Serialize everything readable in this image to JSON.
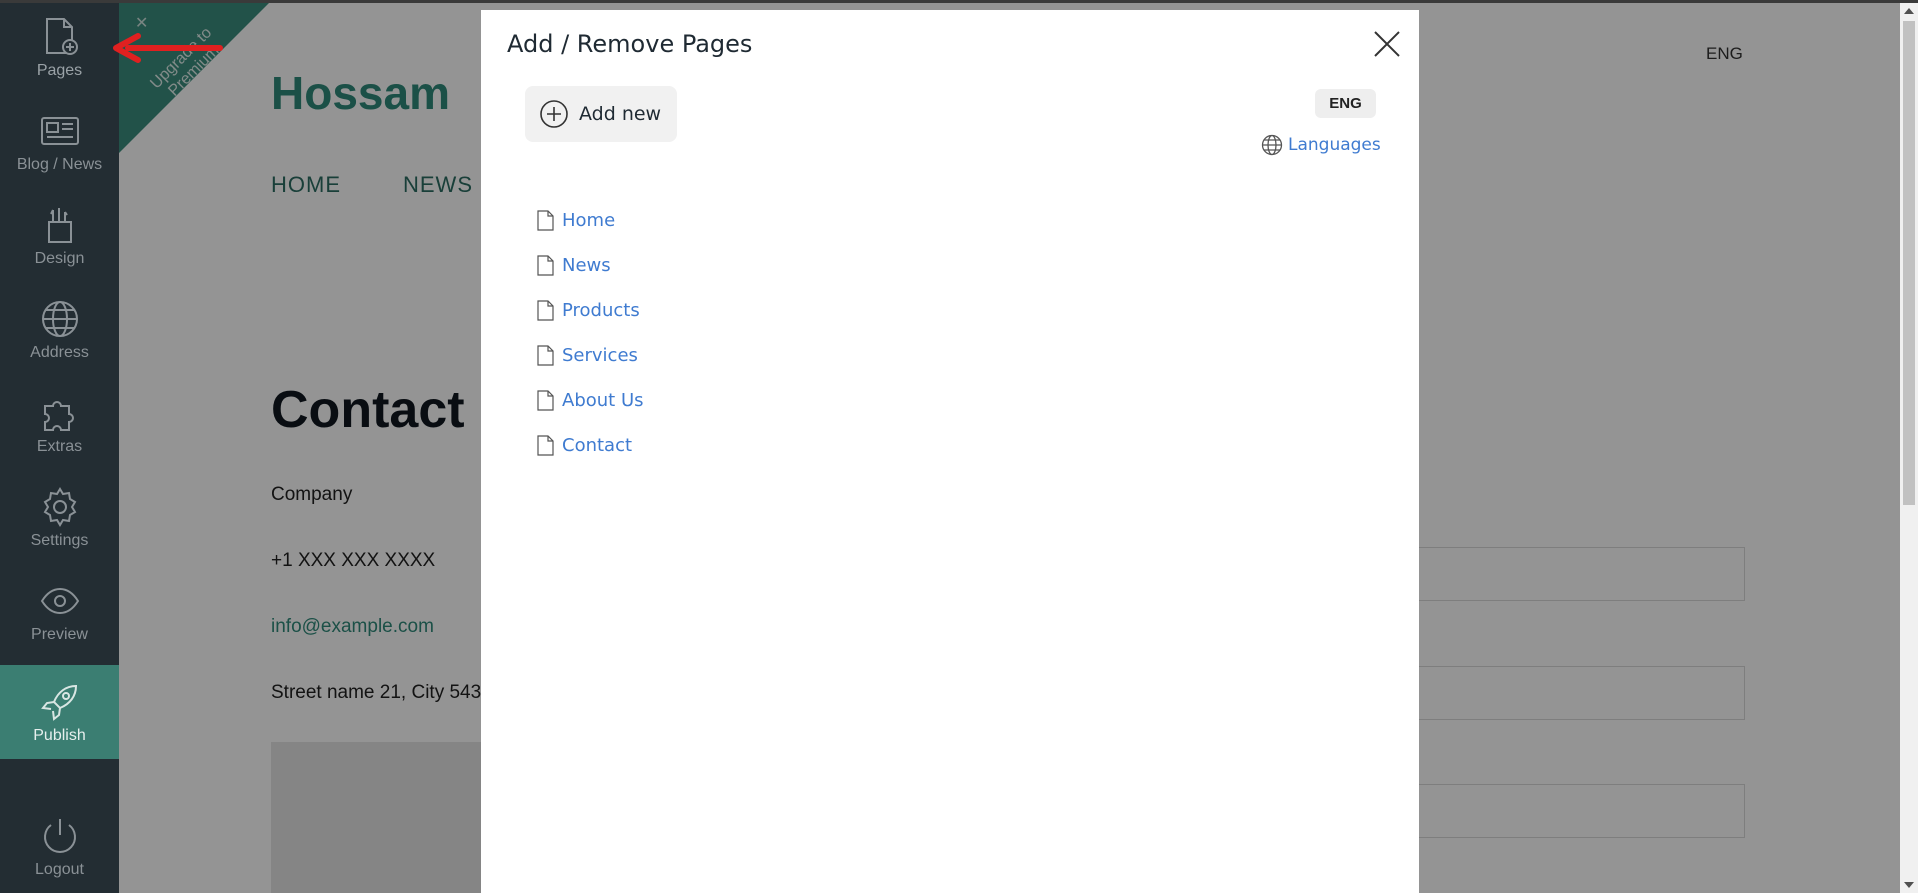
{
  "sidebar": {
    "items": [
      {
        "id": "pages",
        "label": "Pages",
        "icon": "page-add-icon"
      },
      {
        "id": "blog",
        "label": "Blog / News",
        "icon": "newspaper-icon"
      },
      {
        "id": "design",
        "label": "Design",
        "icon": "brush-icon"
      },
      {
        "id": "address",
        "label": "Address",
        "icon": "globe-icon"
      },
      {
        "id": "extras",
        "label": "Extras",
        "icon": "puzzle-icon"
      },
      {
        "id": "settings",
        "label": "Settings",
        "icon": "gear-icon"
      },
      {
        "id": "preview",
        "label": "Preview",
        "icon": "eye-icon"
      },
      {
        "id": "publish",
        "label": "Publish",
        "icon": "rocket-icon"
      }
    ],
    "logout_label": "Logout"
  },
  "site": {
    "ribbon_text": "Upgrade to Premium",
    "brand": "Hossam",
    "nav": [
      "HOME",
      "NEWS"
    ],
    "lang": "ENG",
    "contact_heading": "Contact u",
    "company": "Company",
    "phone": "+1 XXX XXX XXXX",
    "email": "info@example.com",
    "address": "Street name 21, City 543"
  },
  "modal": {
    "title": "Add / Remove Pages",
    "add_new_label": "Add new",
    "lang_badge": "ENG",
    "languages_label": "Languages",
    "pages": [
      "Home",
      "News",
      "Products",
      "Services",
      "About Us",
      "Contact"
    ]
  },
  "colors": {
    "sidebar_bg": "#232d33",
    "accent_green": "#3b8e7f",
    "link_blue": "#3f7bd0",
    "arrow_red": "#e02020"
  }
}
